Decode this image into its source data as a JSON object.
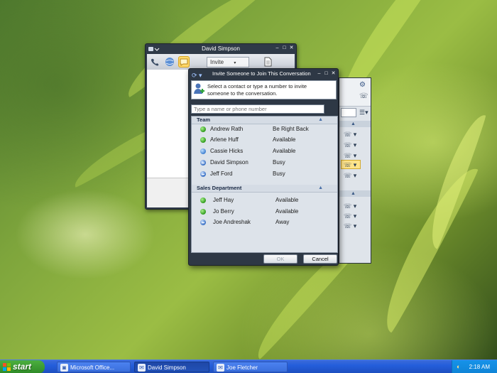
{
  "back_window": {
    "title": "David Simpson",
    "invite_label": "Invite"
  },
  "dialog": {
    "title": "Invite Someone to Join This Conversation",
    "instruction_line1": "Select a contact or type a number to invite",
    "instruction_line2": "someone to the conversation.",
    "search_placeholder": "Type a name or phone number",
    "groups": [
      {
        "name": "Team",
        "contacts": [
          {
            "name": "Andrew Rath",
            "status": "Be Right Back",
            "presence": "green"
          },
          {
            "name": "Arlene Huff",
            "status": "Available",
            "presence": "green"
          },
          {
            "name": "Cassie Hicks",
            "status": "Available",
            "presence": "blue"
          },
          {
            "name": "David Simpson",
            "status": "Busy",
            "presence": "busy"
          },
          {
            "name": "Jeff Ford",
            "status": "Busy",
            "presence": "busy"
          }
        ]
      },
      {
        "name": "Sales Department",
        "contacts": [
          {
            "name": "Jeff Hay",
            "status": "Available",
            "presence": "green"
          },
          {
            "name": "Jo Berry",
            "status": "Available",
            "presence": "green"
          },
          {
            "name": "Joe Andreshak",
            "status": "Away",
            "presence": "busy"
          }
        ]
      }
    ],
    "ok_label": "OK",
    "cancel_label": "Cancel"
  },
  "taskbar": {
    "start_label": "start",
    "tasks": [
      "Microsoft Office...",
      "David Simpson",
      "Joe Fletcher"
    ],
    "clock": "2:18 AM"
  },
  "icons": {
    "phone": "phone-icon",
    "globe": "globe-icon",
    "im": "chat-bubble-icon",
    "contact_add": "add-contact-icon"
  }
}
